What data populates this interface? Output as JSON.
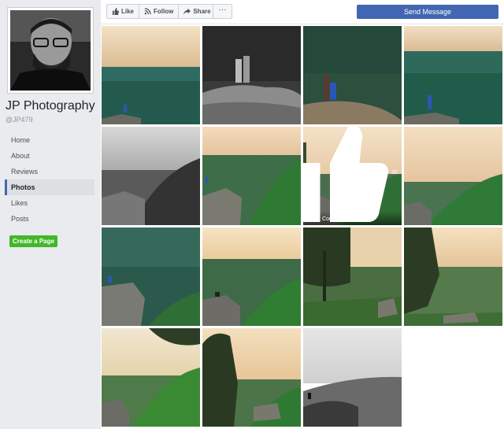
{
  "page": {
    "name": "JP Photography",
    "handle": "@JP479"
  },
  "nav": {
    "items": [
      {
        "label": "Home"
      },
      {
        "label": "About"
      },
      {
        "label": "Reviews"
      },
      {
        "label": "Photos"
      },
      {
        "label": "Likes"
      },
      {
        "label": "Posts"
      }
    ],
    "active": "Photos"
  },
  "create_page_label": "Create a Page",
  "toolbar": {
    "like_label": "Like",
    "follow_label": "Follow",
    "share_label": "Share",
    "more_label": "···",
    "send_message_label": "Send Message"
  },
  "photo_overlay": {
    "like_comment": "Like · Comment",
    "count": "32"
  },
  "colors": {
    "accent": "#4267b2",
    "create_button": "#42b72a"
  },
  "photos": [
    {
      "alt": "sunset ridge with hiker"
    },
    {
      "alt": "couple on rock black and white"
    },
    {
      "alt": "couple on cliff"
    },
    {
      "alt": "hiker on ledge"
    },
    {
      "alt": "black and white valley"
    },
    {
      "alt": "cliff overlook"
    },
    {
      "alt": "valley with overlay"
    },
    {
      "alt": "green hills"
    },
    {
      "alt": "hiker on rock"
    },
    {
      "alt": "couple at sunset"
    },
    {
      "alt": "tree silhouette"
    },
    {
      "alt": "tree and ridge"
    },
    {
      "alt": "valley framed by leaves"
    },
    {
      "alt": "tree and cliff"
    },
    {
      "alt": "black and white overlook"
    }
  ]
}
